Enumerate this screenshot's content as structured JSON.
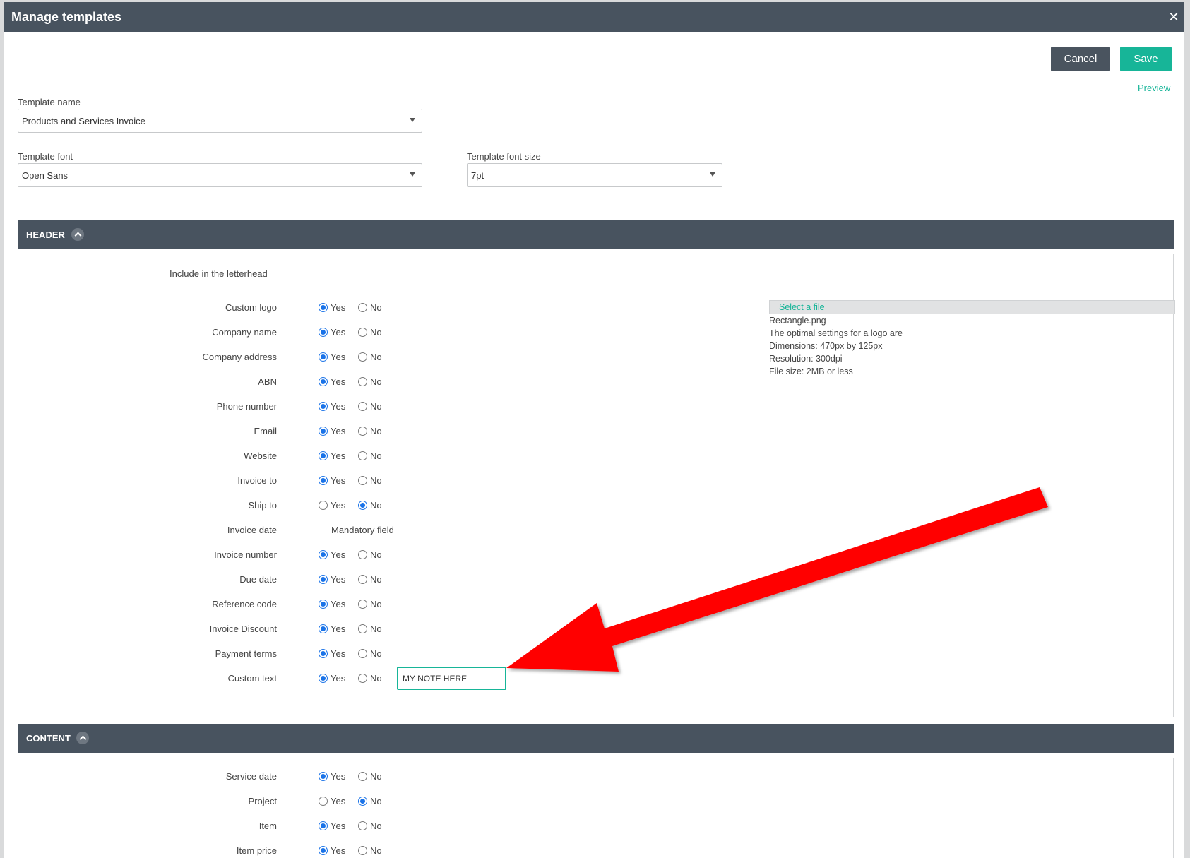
{
  "modal": {
    "title": "Manage templates",
    "close_icon": "✕"
  },
  "actions": {
    "cancel": "Cancel",
    "save": "Save",
    "preview": "Preview"
  },
  "fields": {
    "template_name": {
      "label": "Template name",
      "value": "Products and Services Invoice"
    },
    "template_font": {
      "label": "Template font",
      "value": "Open Sans"
    },
    "template_font_size": {
      "label": "Template font size",
      "value": "7pt"
    }
  },
  "header_section": {
    "title": "HEADER",
    "include_label": "Include in the letterhead",
    "rows": [
      {
        "label": "Custom logo",
        "selected": "yes"
      },
      {
        "label": "Company name",
        "selected": "yes"
      },
      {
        "label": "Company address",
        "selected": "yes"
      },
      {
        "label": "ABN",
        "selected": "yes"
      },
      {
        "label": "Phone number",
        "selected": "yes"
      },
      {
        "label": "Email",
        "selected": "yes"
      },
      {
        "label": "Website",
        "selected": "yes"
      },
      {
        "label": "Invoice to",
        "selected": "yes"
      },
      {
        "label": "Ship to",
        "selected": "no"
      },
      {
        "label": "Invoice date",
        "mandatory": "Mandatory field"
      },
      {
        "label": "Invoice number",
        "selected": "yes"
      },
      {
        "label": "Due date",
        "selected": "yes"
      },
      {
        "label": "Reference code",
        "selected": "yes"
      },
      {
        "label": "Invoice Discount",
        "selected": "yes"
      },
      {
        "label": "Payment terms",
        "selected": "yes"
      },
      {
        "label": "Custom text",
        "selected": "yes",
        "input_value": "MY NOTE HERE"
      }
    ],
    "file": {
      "button": "Select a file",
      "filename": "Rectangle.png",
      "info": [
        "The optimal settings for a logo are",
        "Dimensions: 470px by 125px",
        "Resolution: 300dpi",
        "File size: 2MB or less"
      ]
    }
  },
  "content_section": {
    "title": "CONTENT",
    "rows": [
      {
        "label": "Service date",
        "selected": "yes"
      },
      {
        "label": "Project",
        "selected": "no"
      },
      {
        "label": "Item",
        "selected": "yes"
      },
      {
        "label": "Item price",
        "selected": "yes"
      }
    ]
  },
  "radio_labels": {
    "yes": "Yes",
    "no": "No"
  },
  "colors": {
    "header_bar": "#48535f",
    "accent": "#17b598",
    "radio_selected": "#1a73e8",
    "arrow": "#ff0000"
  }
}
